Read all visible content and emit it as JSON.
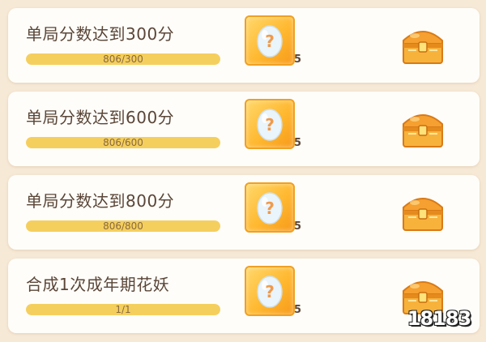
{
  "tasks": [
    {
      "title": "单局分数达到300分",
      "progress_text": "806/300",
      "progress": 1.0,
      "reward_count": "5"
    },
    {
      "title": "单局分数达到600分",
      "progress_text": "806/600",
      "progress": 1.0,
      "reward_count": "5"
    },
    {
      "title": "单局分数达到800分",
      "progress_text": "806/800",
      "progress": 1.0,
      "reward_count": "5"
    },
    {
      "title": "合成1次成年期花妖",
      "progress_text": "1/1",
      "progress": 1.0,
      "reward_count": "5"
    }
  ],
  "reward_icon": "mystery-egg-icon",
  "chest_icon": "treasure-chest-icon",
  "watermark": "18183",
  "colors": {
    "bar_fill": "#f5cf5e",
    "reward_bg": "#ffb830",
    "card_bg": "#fffdf9",
    "page_bg": "#f6e9d6"
  }
}
